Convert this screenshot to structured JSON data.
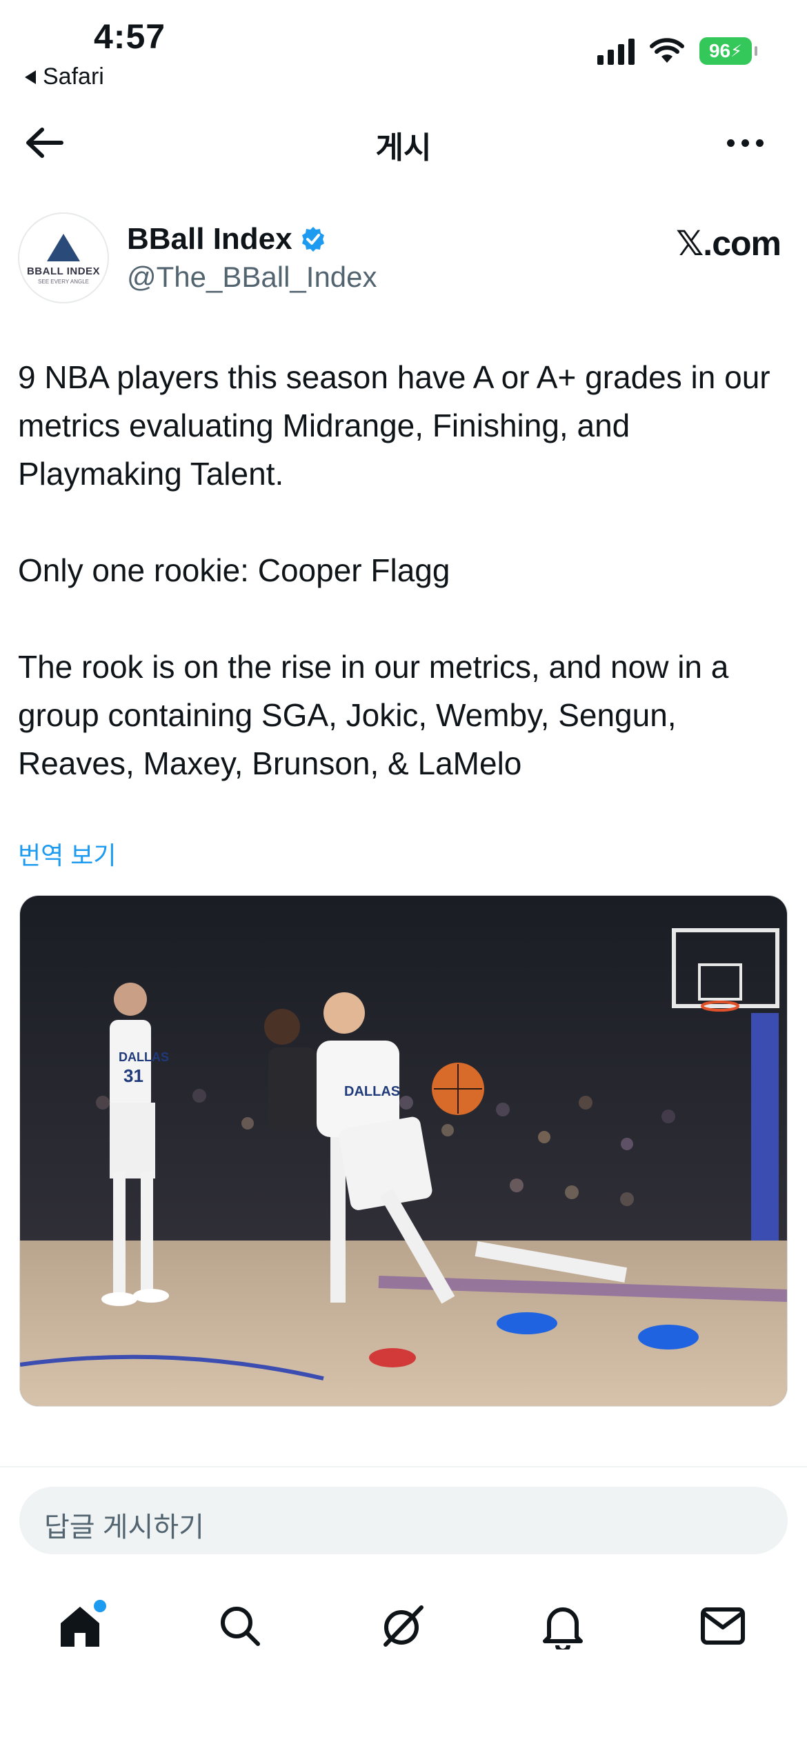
{
  "status_bar": {
    "time": "4:57",
    "back_app": "Safari",
    "battery": "96"
  },
  "nav": {
    "title": "게시"
  },
  "author": {
    "display_name": "BBall Index",
    "handle": "@The_BBall_Index",
    "avatar_name": "BBALL INDEX",
    "avatar_tag": "SEE EVERY ANGLE",
    "source": "𝕏.com"
  },
  "tweet": {
    "text": "9 NBA players this season have A or A+ grades in our metrics evaluating Midrange, Finishing, and Playmaking Talent.\n\nOnly one rookie: Cooper Flagg\n\nThe rook is on the rise in our metrics, and now in a group containing SGA, Jokic, Wemby, Sengun, Reaves, Maxey, Brunson, & LaMelo",
    "translate": "번역 보기"
  },
  "media": {
    "player1_jersey": "31",
    "player1_team": "DALLAS",
    "player2_team": "DALLAS"
  },
  "reply": {
    "placeholder": "답글 게시하기"
  },
  "tabs": [
    {
      "icon": "home-icon",
      "active": true,
      "has_dot": true
    },
    {
      "icon": "search-icon"
    },
    {
      "icon": "grok-icon"
    },
    {
      "icon": "bell-icon"
    },
    {
      "icon": "mail-icon"
    }
  ],
  "colors": {
    "accent": "#1d9bf0",
    "battery": "#34c759",
    "text": "#0f1419",
    "secondary": "#536471"
  }
}
